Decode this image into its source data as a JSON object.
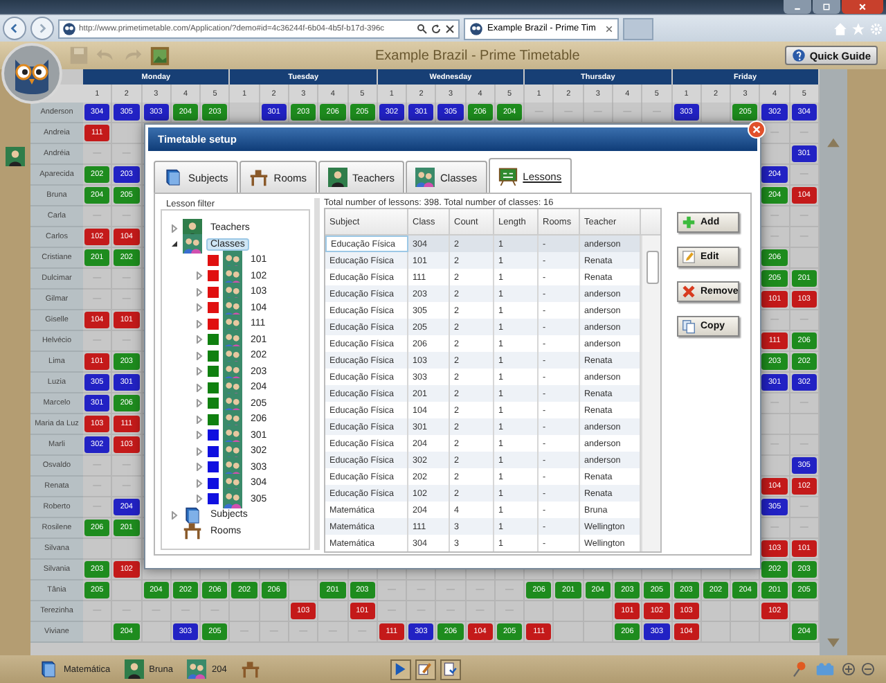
{
  "browser": {
    "address": "http://www.primetimetable.com/Application/?demo#id=4c36244f-6b04-4b5f-b17d-396c",
    "tab_title": "Example Brazil - Prime Tim"
  },
  "app": {
    "title": "Example Brazil - Prime Timetable",
    "quick_guide": "Quick Guide"
  },
  "grid": {
    "days": [
      {
        "name": "Monday",
        "periods": [
          "1",
          "2",
          "3",
          "4",
          "5"
        ]
      },
      {
        "name": "Tuesday",
        "periods": [
          "1",
          "2",
          "3",
          "4",
          "5"
        ]
      },
      {
        "name": "Wednesday",
        "periods": [
          "1",
          "2",
          "3",
          "4",
          "5"
        ]
      },
      {
        "name": "Thursday",
        "periods": [
          "1",
          "2",
          "3",
          "4",
          "5"
        ]
      },
      {
        "name": "Friday",
        "periods": [
          "1",
          "2",
          "3",
          "4",
          "5"
        ]
      }
    ],
    "rows": [
      {
        "name": "Anderson",
        "cells": [
          {
            "text": "304",
            "color": "#2222c4"
          },
          {
            "text": "305",
            "color": "#2222c4"
          },
          {
            "text": "303",
            "color": "#2222c4"
          },
          {
            "text": "204",
            "color": "#1e8c1e"
          },
          {
            "text": "203",
            "color": "#1e8c1e"
          },
          null,
          {
            "text": "301",
            "color": "#2222c4"
          },
          {
            "text": "203",
            "color": "#1e8c1e"
          },
          {
            "text": "206",
            "color": "#1e8c1e"
          },
          {
            "text": "205",
            "color": "#1e8c1e"
          },
          {
            "text": "302",
            "color": "#2222c4"
          },
          {
            "text": "301",
            "color": "#2222c4"
          },
          {
            "text": "305",
            "color": "#2222c4"
          },
          {
            "text": "206",
            "color": "#1e8c1e"
          },
          {
            "text": "204",
            "color": "#1e8c1e"
          },
          {
            "text": "—"
          },
          {
            "text": "—"
          },
          {
            "text": "—"
          },
          {
            "text": "—"
          },
          {
            "text": "—"
          },
          {
            "text": "303",
            "color": "#2222c4"
          },
          null,
          {
            "text": "205",
            "color": "#1e8c1e"
          },
          {
            "text": "302",
            "color": "#2222c4"
          },
          {
            "text": "304",
            "color": "#2222c4"
          }
        ]
      },
      {
        "name": "Andreia",
        "first_cells": [
          {
            "text": "111",
            "color": "#c41a1a"
          },
          null
        ],
        "last_cells": [
          {
            "text": "—"
          },
          {
            "text": "—"
          }
        ]
      },
      {
        "name": "Andréia",
        "first_cells": [
          {
            "text": "—"
          },
          {
            "text": "—"
          }
        ],
        "last_cells": [
          null,
          {
            "text": "301",
            "color": "#2222c4"
          }
        ]
      },
      {
        "name": "Aparecida",
        "first_cells": [
          {
            "text": "202",
            "color": "#1e8c1e"
          },
          {
            "text": "203",
            "color": "#2222c4"
          }
        ],
        "last_cells": [
          {
            "text": "204",
            "color": "#2222c4"
          },
          {
            "text": "—"
          }
        ]
      },
      {
        "name": "Bruna",
        "first_cells": [
          {
            "text": "204",
            "color": "#1e8c1e"
          },
          {
            "text": "205",
            "color": "#1e8c1e"
          }
        ],
        "last_cells": [
          {
            "text": "204",
            "color": "#1e8c1e"
          },
          {
            "text": "104",
            "color": "#c41a1a"
          }
        ]
      },
      {
        "name": "Carla",
        "first_cells": [
          {
            "text": "—"
          },
          {
            "text": "—"
          }
        ],
        "last_cells": [
          {
            "text": "—"
          },
          {
            "text": "—"
          }
        ]
      },
      {
        "name": "Carlos",
        "first_cells": [
          {
            "text": "102",
            "color": "#c41a1a"
          },
          {
            "text": "104",
            "color": "#c41a1a"
          }
        ],
        "last_cells": [
          {
            "text": "—"
          },
          {
            "text": "—"
          }
        ]
      },
      {
        "name": "Cristiane",
        "first_cells": [
          {
            "text": "201",
            "color": "#1e8c1e"
          },
          {
            "text": "202",
            "color": "#1e8c1e"
          }
        ],
        "last_cells": [
          {
            "text": "206",
            "color": "#1e8c1e"
          },
          null
        ]
      },
      {
        "name": "Dulcimar",
        "first_cells": [
          {
            "text": "—"
          },
          {
            "text": "—"
          }
        ],
        "last_cells": [
          {
            "text": "205",
            "color": "#1e8c1e"
          },
          {
            "text": "201",
            "color": "#1e8c1e"
          }
        ]
      },
      {
        "name": "Gilmar",
        "first_cells": [
          {
            "text": "—"
          },
          {
            "text": "—"
          }
        ],
        "last_cells": [
          {
            "text": "101",
            "color": "#c41a1a"
          },
          {
            "text": "103",
            "color": "#c41a1a"
          }
        ]
      },
      {
        "name": "Giselle",
        "first_cells": [
          {
            "text": "104",
            "color": "#c41a1a"
          },
          {
            "text": "101",
            "color": "#c41a1a"
          }
        ],
        "last_cells": [
          {
            "text": "—"
          },
          {
            "text": "—"
          }
        ]
      },
      {
        "name": "Helvécio",
        "first_cells": [
          {
            "text": "—"
          },
          {
            "text": "—"
          }
        ],
        "last_cells": [
          {
            "text": "111",
            "color": "#c41a1a"
          },
          {
            "text": "206",
            "color": "#1e8c1e"
          }
        ]
      },
      {
        "name": "Lima",
        "first_cells": [
          {
            "text": "101",
            "color": "#c41a1a"
          },
          {
            "text": "203",
            "color": "#1e8c1e"
          }
        ],
        "last_cells": [
          {
            "text": "203",
            "color": "#1e8c1e"
          },
          {
            "text": "202",
            "color": "#1e8c1e"
          }
        ]
      },
      {
        "name": "Luzia",
        "first_cells": [
          {
            "text": "305",
            "color": "#2222c4"
          },
          {
            "text": "301",
            "color": "#2222c4"
          }
        ],
        "last_cells": [
          {
            "text": "301",
            "color": "#2222c4"
          },
          {
            "text": "302",
            "color": "#2222c4"
          }
        ]
      },
      {
        "name": "Marcelo",
        "first_cells": [
          {
            "text": "301",
            "color": "#2222c4"
          },
          {
            "text": "206",
            "color": "#1e8c1e"
          }
        ],
        "last_cells": [
          {
            "text": "—"
          },
          {
            "text": "—"
          }
        ]
      },
      {
        "name": "Maria da Luz",
        "first_cells": [
          {
            "text": "103",
            "color": "#c41a1a"
          },
          {
            "text": "111",
            "color": "#c41a1a"
          }
        ],
        "last_cells": [
          null,
          null
        ]
      },
      {
        "name": "Marli",
        "first_cells": [
          {
            "text": "302",
            "color": "#2222c4"
          },
          {
            "text": "103",
            "color": "#c41a1a"
          }
        ],
        "last_cells": [
          {
            "text": "—"
          },
          {
            "text": "—"
          }
        ]
      },
      {
        "name": "Osvaldo",
        "first_cells": [
          {
            "text": "—"
          },
          {
            "text": "—"
          }
        ],
        "last_cells": [
          null,
          {
            "text": "305",
            "color": "#2222c4"
          }
        ]
      },
      {
        "name": "Renata",
        "first_cells": [
          {
            "text": "—"
          },
          {
            "text": "—"
          }
        ],
        "last_cells": [
          {
            "text": "104",
            "color": "#c41a1a"
          },
          {
            "text": "102",
            "color": "#c41a1a"
          }
        ]
      },
      {
        "name": "Roberto",
        "first_cells": [
          {
            "text": "—"
          },
          {
            "text": "204",
            "color": "#2222c4"
          }
        ],
        "last_cells": [
          {
            "text": "305",
            "color": "#2222c4"
          },
          {
            "text": "—"
          }
        ]
      },
      {
        "name": "Rosilene",
        "first_cells": [
          {
            "text": "206",
            "color": "#1e8c1e"
          },
          {
            "text": "201",
            "color": "#1e8c1e"
          }
        ],
        "last_cells": [
          {
            "text": "—"
          },
          {
            "text": "—"
          }
        ]
      },
      {
        "name": "Silvana",
        "first_cells": [
          null,
          null
        ],
        "last_cells": [
          {
            "text": "103",
            "color": "#c41a1a"
          },
          {
            "text": "101",
            "color": "#c41a1a"
          }
        ]
      },
      {
        "name": "Silvania",
        "first_cells": [
          {
            "text": "203",
            "color": "#1e8c1e"
          },
          {
            "text": "102",
            "color": "#c41a1a"
          }
        ],
        "last_cells": [
          {
            "text": "202",
            "color": "#1e8c1e"
          },
          {
            "text": "203",
            "color": "#1e8c1e"
          }
        ]
      },
      {
        "name": "Tânia",
        "cells": [
          {
            "text": "205",
            "color": "#1e8c1e"
          },
          null,
          {
            "text": "204",
            "color": "#1e8c1e"
          },
          {
            "text": "202",
            "color": "#1e8c1e"
          },
          {
            "text": "206",
            "color": "#1e8c1e"
          },
          {
            "text": "202",
            "color": "#1e8c1e"
          },
          {
            "text": "206",
            "color": "#1e8c1e"
          },
          null,
          {
            "text": "201",
            "color": "#1e8c1e"
          },
          {
            "text": "203",
            "color": "#1e8c1e"
          },
          {
            "text": "—"
          },
          {
            "text": "—"
          },
          {
            "text": "—"
          },
          {
            "text": "—"
          },
          {
            "text": "—"
          },
          {
            "text": "206",
            "color": "#1e8c1e"
          },
          {
            "text": "201",
            "color": "#1e8c1e"
          },
          {
            "text": "204",
            "color": "#1e8c1e"
          },
          {
            "text": "203",
            "color": "#1e8c1e"
          },
          {
            "text": "205",
            "color": "#1e8c1e"
          },
          {
            "text": "203",
            "color": "#1e8c1e"
          },
          {
            "text": "202",
            "color": "#1e8c1e"
          },
          {
            "text": "204",
            "color": "#1e8c1e"
          },
          {
            "text": "201",
            "color": "#1e8c1e"
          },
          {
            "text": "205",
            "color": "#1e8c1e"
          }
        ]
      },
      {
        "name": "Terezinha",
        "cells": [
          {
            "text": "—"
          },
          {
            "text": "—"
          },
          {
            "text": "—"
          },
          {
            "text": "—"
          },
          {
            "text": "—"
          },
          null,
          null,
          {
            "text": "103",
            "color": "#c41a1a"
          },
          null,
          {
            "text": "101",
            "color": "#c41a1a"
          },
          {
            "text": "—"
          },
          {
            "text": "—"
          },
          {
            "text": "—"
          },
          {
            "text": "—"
          },
          {
            "text": "—"
          },
          null,
          null,
          null,
          {
            "text": "101",
            "color": "#c41a1a"
          },
          {
            "text": "102",
            "color": "#c41a1a"
          },
          {
            "text": "103",
            "color": "#c41a1a"
          },
          null,
          null,
          {
            "text": "102",
            "color": "#c41a1a"
          },
          null
        ]
      },
      {
        "name": "Viviane",
        "cells": [
          null,
          {
            "text": "204",
            "color": "#1e8c1e"
          },
          null,
          {
            "text": "303",
            "color": "#2222c4"
          },
          {
            "text": "205",
            "color": "#1e8c1e"
          },
          {
            "text": "—"
          },
          {
            "text": "—"
          },
          {
            "text": "—"
          },
          {
            "text": "—"
          },
          {
            "text": "—"
          },
          {
            "text": "111",
            "color": "#c41a1a"
          },
          {
            "text": "303",
            "color": "#2222c4"
          },
          {
            "text": "206",
            "color": "#1e8c1e"
          },
          {
            "text": "104",
            "color": "#c41a1a"
          },
          {
            "text": "205",
            "color": "#1e8c1e"
          },
          {
            "text": "111",
            "color": "#c41a1a"
          },
          null,
          null,
          {
            "text": "206",
            "color": "#1e8c1e"
          },
          {
            "text": "303",
            "color": "#2222c4"
          },
          {
            "text": "104",
            "color": "#c41a1a"
          },
          null,
          null,
          null,
          {
            "text": "204",
            "color": "#1e8c1e"
          }
        ]
      }
    ]
  },
  "dialog": {
    "title": "Timetable setup",
    "tabs": [
      {
        "label": "Subjects",
        "kind": "subjects",
        "selected": false
      },
      {
        "label": "Rooms",
        "kind": "rooms",
        "selected": false
      },
      {
        "label": "Teachers",
        "kind": "teachers",
        "selected": false
      },
      {
        "label": "Classes",
        "kind": "classes",
        "selected": false
      },
      {
        "label": "Lessons",
        "kind": "lessons",
        "selected": true
      }
    ],
    "filter_label": "Lesson filter",
    "tree": [
      {
        "label": "Teachers",
        "kind": "teachers",
        "expanded": false,
        "selected": false
      },
      {
        "label": "Classes",
        "kind": "classes",
        "expanded": true,
        "selected": true,
        "children": [
          {
            "label": "101",
            "color": "#e01010",
            "selected": false
          },
          {
            "label": "102",
            "color": "#e01010",
            "expanded": false,
            "selected": false
          },
          {
            "label": "103",
            "color": "#e01010",
            "expanded": false,
            "selected": false
          },
          {
            "label": "104",
            "color": "#e01010",
            "expanded": false,
            "selected": false
          },
          {
            "label": "111",
            "color": "#e01010",
            "expanded": false,
            "selected": false
          },
          {
            "label": "201",
            "color": "#108010",
            "expanded": false,
            "selected": false
          },
          {
            "label": "202",
            "color": "#108010",
            "expanded": false,
            "selected": false
          },
          {
            "label": "203",
            "color": "#108010",
            "expanded": false,
            "selected": false
          },
          {
            "label": "204",
            "color": "#108010",
            "expanded": false,
            "selected": false
          },
          {
            "label": "205",
            "color": "#108010",
            "expanded": false,
            "selected": false
          },
          {
            "label": "206",
            "color": "#108010",
            "expanded": false,
            "selected": false
          },
          {
            "label": "301",
            "color": "#1010e0",
            "expanded": false,
            "selected": false
          },
          {
            "label": "302",
            "color": "#1010e0",
            "expanded": false,
            "selected": false
          },
          {
            "label": "303",
            "color": "#1010e0",
            "expanded": false,
            "selected": false
          },
          {
            "label": "304",
            "color": "#1010e0",
            "expanded": false,
            "selected": false
          },
          {
            "label": "305",
            "color": "#1010e0",
            "expanded": false,
            "selected": false
          }
        ]
      },
      {
        "label": "Subjects",
        "kind": "subjects",
        "expanded": false,
        "selected": false
      },
      {
        "label": "Rooms",
        "kind": "rooms",
        "selected": false
      }
    ],
    "summary": "Total number of lessons: 398. Total number of classes: 16",
    "table": {
      "columns": [
        "Subject",
        "Class",
        "Count",
        "Length",
        "Rooms",
        "Teacher"
      ],
      "rows": [
        {
          "subject": "Educação Física",
          "class": "304",
          "count": "2",
          "length": "1",
          "rooms": "-",
          "teacher": "anderson",
          "selected": true
        },
        {
          "subject": "Educação Física",
          "class": "101",
          "count": "2",
          "length": "1",
          "rooms": "-",
          "teacher": "Renata",
          "selected": false
        },
        {
          "subject": "Educação Física",
          "class": "111",
          "count": "2",
          "length": "1",
          "rooms": "-",
          "teacher": "Renata",
          "selected": false
        },
        {
          "subject": "Educação Física",
          "class": "203",
          "count": "2",
          "length": "1",
          "rooms": "-",
          "teacher": "anderson",
          "selected": false
        },
        {
          "subject": "Educação Física",
          "class": "305",
          "count": "2",
          "length": "1",
          "rooms": "-",
          "teacher": "anderson",
          "selected": false
        },
        {
          "subject": "Educação Física",
          "class": "205",
          "count": "2",
          "length": "1",
          "rooms": "-",
          "teacher": "anderson",
          "selected": false
        },
        {
          "subject": "Educação Física",
          "class": "206",
          "count": "2",
          "length": "1",
          "rooms": "-",
          "teacher": "anderson",
          "selected": false
        },
        {
          "subject": "Educação Física",
          "class": "103",
          "count": "2",
          "length": "1",
          "rooms": "-",
          "teacher": "Renata",
          "selected": false
        },
        {
          "subject": "Educação Física",
          "class": "303",
          "count": "2",
          "length": "1",
          "rooms": "-",
          "teacher": "anderson",
          "selected": false
        },
        {
          "subject": "Educação Física",
          "class": "201",
          "count": "2",
          "length": "1",
          "rooms": "-",
          "teacher": "Renata",
          "selected": false
        },
        {
          "subject": "Educação Física",
          "class": "104",
          "count": "2",
          "length": "1",
          "rooms": "-",
          "teacher": "Renata",
          "selected": false
        },
        {
          "subject": "Educação Física",
          "class": "301",
          "count": "2",
          "length": "1",
          "rooms": "-",
          "teacher": "anderson",
          "selected": false
        },
        {
          "subject": "Educação Física",
          "class": "204",
          "count": "2",
          "length": "1",
          "rooms": "-",
          "teacher": "anderson",
          "selected": false
        },
        {
          "subject": "Educação Física",
          "class": "302",
          "count": "2",
          "length": "1",
          "rooms": "-",
          "teacher": "anderson",
          "selected": false
        },
        {
          "subject": "Educação Física",
          "class": "202",
          "count": "2",
          "length": "1",
          "rooms": "-",
          "teacher": "Renata",
          "selected": false
        },
        {
          "subject": "Educação Física",
          "class": "102",
          "count": "2",
          "length": "1",
          "rooms": "-",
          "teacher": "Renata",
          "selected": false
        },
        {
          "subject": "Matemática",
          "class": "204",
          "count": "4",
          "length": "1",
          "rooms": "-",
          "teacher": "Bruna",
          "selected": false
        },
        {
          "subject": "Matemática",
          "class": "111",
          "count": "3",
          "length": "1",
          "rooms": "-",
          "teacher": "Wellington",
          "selected": false
        },
        {
          "subject": "Matemática",
          "class": "304",
          "count": "3",
          "length": "1",
          "rooms": "-",
          "teacher": "Wellington",
          "selected": false
        }
      ]
    },
    "buttons": [
      {
        "label": "Add",
        "kind": "add"
      },
      {
        "label": "Edit",
        "kind": "edit"
      },
      {
        "label": "Remove",
        "kind": "remove"
      },
      {
        "label": "Copy",
        "kind": "copy"
      }
    ]
  },
  "status_bar": {
    "subject": "Matemática",
    "teacher": "Bruna",
    "class": "204"
  }
}
